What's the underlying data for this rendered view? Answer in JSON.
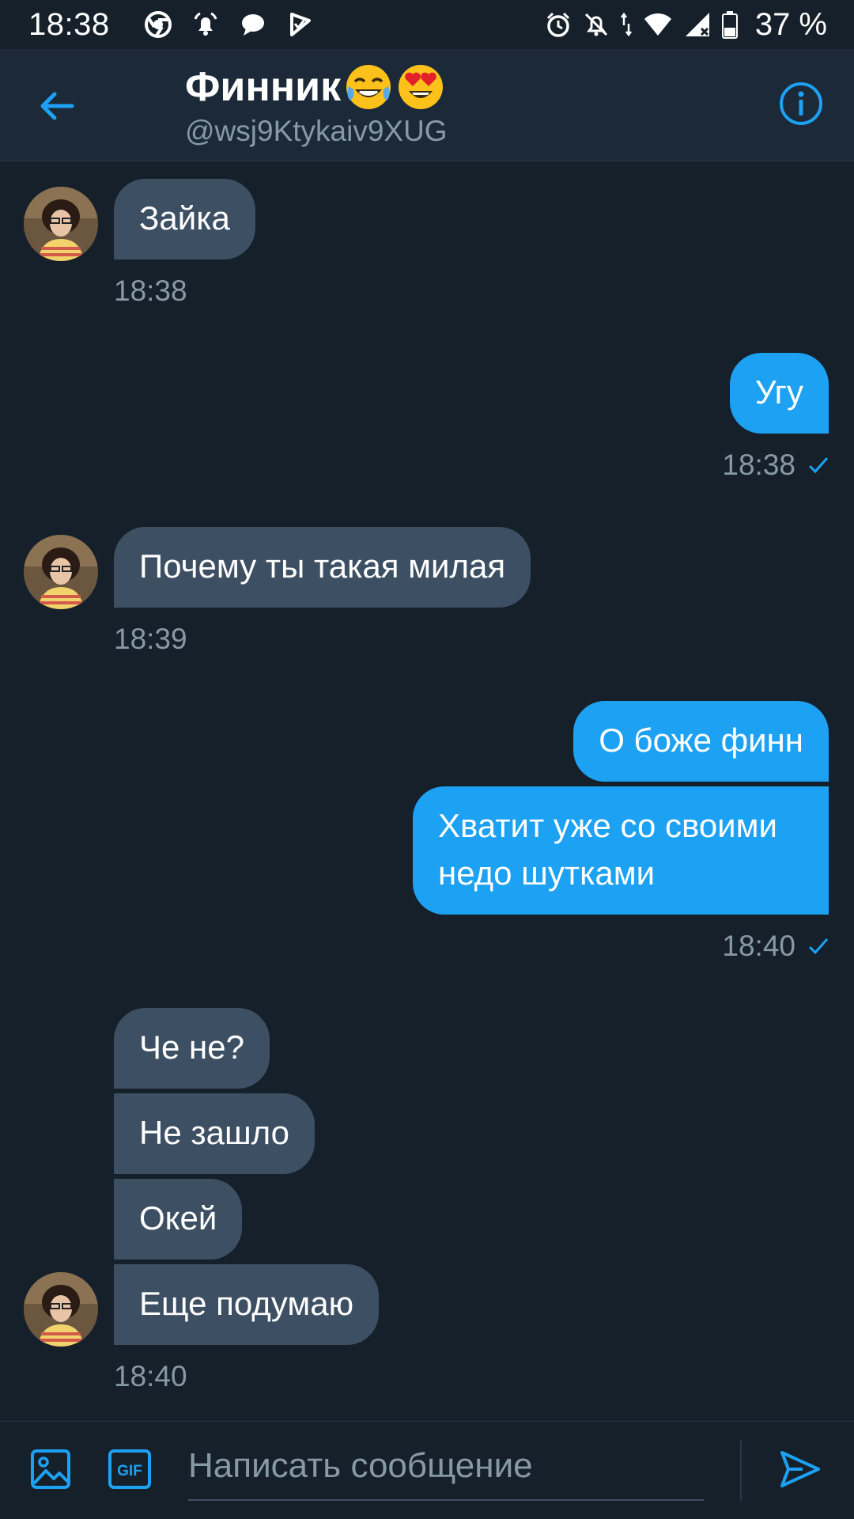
{
  "status_bar": {
    "time": "18:38",
    "battery": "37 %"
  },
  "header": {
    "title": "Финник",
    "handle": "@wsj9Ktykaiv9XUG"
  },
  "messages": [
    {
      "direction": "incoming",
      "text": "Зайка",
      "time": "18:38"
    },
    {
      "direction": "outgoing",
      "text": "Угу",
      "time": "18:38"
    },
    {
      "direction": "incoming",
      "text": "Почему ты такая милая",
      "time": "18:39"
    },
    {
      "direction": "outgoing",
      "text": "О боже финн"
    },
    {
      "direction": "outgoing",
      "text": "Хватит уже со своими недо шутками",
      "time": "18:40"
    },
    {
      "direction": "incoming",
      "text": "Че не?"
    },
    {
      "direction": "incoming",
      "text": "Не зашло"
    },
    {
      "direction": "incoming",
      "text": "Окей"
    },
    {
      "direction": "incoming",
      "text": "Еще подумаю",
      "time": "18:40"
    }
  ],
  "composer": {
    "placeholder": "Написать сообщение",
    "gif_label": "GIF"
  },
  "colors": {
    "background": "#15202b",
    "header": "#1c2938",
    "accent": "#1da1f2",
    "incoming_bubble": "#3d4f63",
    "muted_text": "#8899a6"
  }
}
